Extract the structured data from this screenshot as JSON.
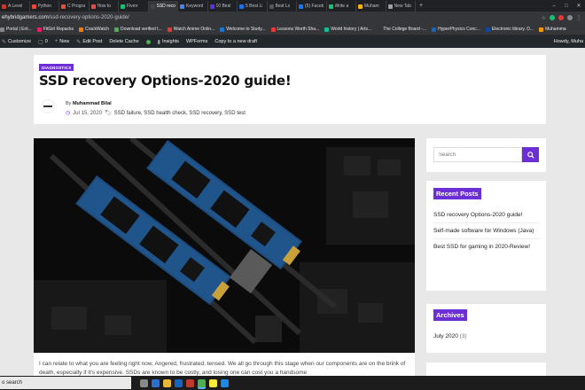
{
  "browser": {
    "tabs": [
      {
        "label": "A Level",
        "color": "#c0392b"
      },
      {
        "label": "Python",
        "color": "#e74c3c"
      },
      {
        "label": "C Progra",
        "color": "#e74c3c"
      },
      {
        "label": "How to",
        "color": "#e74c3c"
      },
      {
        "label": "Fiverr",
        "color": "#1dbf73"
      },
      {
        "label": "SSD reco",
        "color": "#444",
        "active": true
      },
      {
        "label": "Keyword",
        "color": "#4285f4"
      },
      {
        "label": "10 Best",
        "color": "#5f2eea"
      },
      {
        "label": "5 Best Li",
        "color": "#1a73e8"
      },
      {
        "label": "Best Lo",
        "color": "#555"
      },
      {
        "label": "(5) Faceb",
        "color": "#1877f2"
      },
      {
        "label": "Write a",
        "color": "#1dbf73"
      },
      {
        "label": "Muham",
        "color": "#f4b400"
      },
      {
        "label": "New Tab",
        "color": "#9aa0a6"
      }
    ],
    "new_tab_glyph": "+",
    "window_controls": [
      "–",
      "□",
      "✕"
    ],
    "url_domain": "ehybridgamers.com",
    "url_path": "/ssd-recovery-options-2020-guide/",
    "bookmarks": [
      {
        "label": "Portal | Ent...",
        "color": "#888"
      },
      {
        "label": "FitGirl Repacks",
        "color": "#e91e63"
      },
      {
        "label": "CrackWatch",
        "color": "#f57c00"
      },
      {
        "label": "Download verified t...",
        "color": "#4caf50"
      },
      {
        "label": "Watch Anime Onlin...",
        "color": "#e53935"
      },
      {
        "label": "Welcome to Study...",
        "color": "#1976d2"
      },
      {
        "label": "Lessons Worth Sha...",
        "color": "#e53935"
      },
      {
        "label": "World history | Arts...",
        "color": "#14bf96"
      },
      {
        "label": "The College Board -...",
        "color": "#333"
      },
      {
        "label": "HyperPhysics Conc...",
        "color": "#1565c0"
      },
      {
        "label": "Electronic library. D...",
        "color": "#0d47a1"
      },
      {
        "label": "Muhamma",
        "color": "#ff9800"
      }
    ]
  },
  "wpbar": {
    "site": "",
    "customize": "Customize",
    "comments_count": "0",
    "new": "New",
    "edit_post": "Edit Post",
    "delete_cache": "Delete Cache",
    "insights": "Insights",
    "wpforms": "WPForms",
    "copy_draft": "Copy to a new draft",
    "howdy": "Howdy, Muha"
  },
  "post": {
    "category": "DIAGNOSTICS",
    "title": "SSD recovery Options-2020 guide!",
    "by_prefix": "By",
    "author": "Muhammad Bilal",
    "date": "Jul 15, 2020",
    "tags": "SSD failure, SSD health check, SSD recovery, SSD test",
    "excerpt": "I can relate to what you are feeling right now, Angered, frustrated, tensed. We all go through this stage when our components are on the brink of death, especially if it's expensive. SSDs are known to be costly, and losing one can cost you a handsome"
  },
  "sidebar": {
    "search_placeholder": "Search",
    "recent_posts_title": "Recent Posts",
    "recent_posts": [
      "SSD recovery Options-2020 guide!",
      "Self-made software for Windows (Java)",
      "Best SSD for gaming in 2020-Review!"
    ],
    "archives_title": "Archives",
    "archives": [
      {
        "label": "July 2020",
        "count": "(3)"
      }
    ]
  },
  "taskbar": {
    "search_text": "o search"
  },
  "colors": {
    "accent": "#6c2fd6",
    "admin_bar": "#23282d",
    "browser_chrome": "#35363a"
  }
}
